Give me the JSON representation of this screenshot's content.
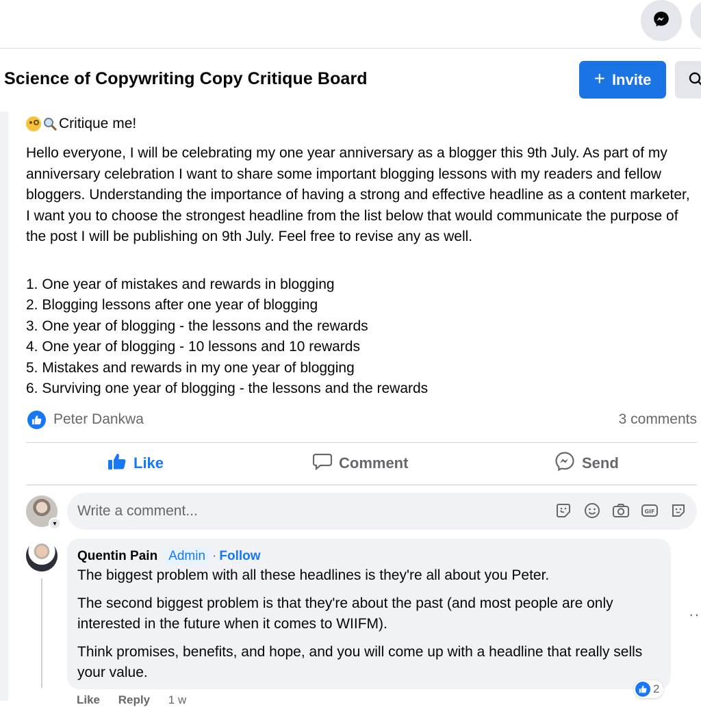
{
  "group": {
    "title": "Science of Copywriting Copy Critique Board",
    "invite_label": "Invite"
  },
  "post": {
    "title": "Critique me!",
    "body": "Hello everyone, I will be celebrating my one year anniversary as a blogger this 9th July. As part of my anniversary celebration I want to share some important blogging lessons with my readers and fellow bloggers. Understanding the importance of having a strong and effective headline as a content marketer, I want you to choose the strongest headline from the list below that would communicate the purpose of the post I will be publishing on 9th July. Feel free to revise any as well.",
    "headlines": [
      "1. One year of mistakes and rewards in blogging",
      "2. Blogging lessons after one year of blogging",
      "3. One year of blogging - the lessons and the rewards",
      "4. One year of blogging - 10 lessons and 10 rewards",
      "5. Mistakes and rewards in my one year of blogging",
      "6. Surviving one year of blogging - the lessons and the rewards"
    ],
    "reactor_name": "Peter Dankwa",
    "comments_count": "3 comments",
    "actions": {
      "like": "Like",
      "comment": "Comment",
      "send": "Send"
    }
  },
  "composer": {
    "placeholder": "Write a comment..."
  },
  "comment": {
    "author": "Quentin Pain",
    "badge": "Admin",
    "separator": "·",
    "follow": "Follow",
    "paragraphs": [
      "The biggest problem with all these headlines is they're all about you Peter.",
      "The second biggest problem is that they're about the past (and most people are only interested in the future when it comes to WIIFM).",
      "Think promises, benefits, and hope, and you will come up with a headline that really sells your value."
    ],
    "reaction_count": "2",
    "more": "···",
    "footer": {
      "like": "Like",
      "reply": "Reply",
      "time": "1 w"
    }
  },
  "colors": {
    "accent": "#1877f2",
    "invite_bg": "#1b74e4",
    "secondary_text": "#65676b",
    "bubble_bg": "#f0f2f5"
  },
  "icons": [
    "messenger-icon",
    "plus-icon",
    "search-icon",
    "magnifier-emoji",
    "face-emoji",
    "like-reaction-icon",
    "thumbs-up-icon",
    "comment-icon",
    "send-messenger-icon",
    "sticker-icon",
    "smiley-icon",
    "camera-icon",
    "gif-icon",
    "avatar-sticker-icon",
    "more-options-icon"
  ]
}
